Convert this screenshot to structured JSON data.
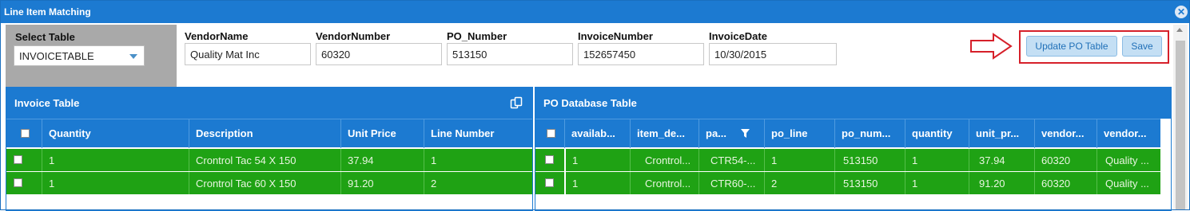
{
  "window": {
    "title": "Line Item Matching",
    "close_icon": "close-icon"
  },
  "select_table": {
    "label": "Select Table",
    "value": "INVOICETABLE"
  },
  "fields": [
    {
      "label": "VendorName",
      "value": "Quality Mat Inc"
    },
    {
      "label": "VendorNumber",
      "value": "60320"
    },
    {
      "label": "PO_Number",
      "value": "513150"
    },
    {
      "label": "InvoiceNumber",
      "value": "152657450"
    },
    {
      "label": "InvoiceDate",
      "value": "10/30/2015"
    }
  ],
  "toolbar": {
    "update_label": "Update PO Table",
    "save_label": "Save"
  },
  "invoice_table": {
    "title": "Invoice Table",
    "columns": [
      "Quantity",
      "Description",
      "Unit Price",
      "Line Number"
    ],
    "rows": [
      [
        "1",
        "Crontrol Tac 54 X 150",
        "37.94",
        "1"
      ],
      [
        "1",
        "Crontrol Tac 60 X 150",
        "91.20",
        "2"
      ]
    ]
  },
  "po_table": {
    "title": "PO Database Table",
    "columns": [
      "availab...",
      "item_de...",
      "pa...",
      "po_line",
      "po_num...",
      "quantity",
      "unit_pr...",
      "vendor...",
      "vendor..."
    ],
    "rows": [
      [
        "1",
        "Crontrol...",
        "CTR54-...",
        "1",
        "513150",
        "1",
        "37.94",
        "60320",
        "Quality ..."
      ],
      [
        "1",
        "Crontrol...",
        "CTR60-...",
        "2",
        "513150",
        "1",
        "91.20",
        "60320",
        "Quality ..."
      ]
    ]
  },
  "colors": {
    "header_blue": "#1c7ad1",
    "row_green": "#1fa214",
    "highlight_red": "#d6202a"
  }
}
